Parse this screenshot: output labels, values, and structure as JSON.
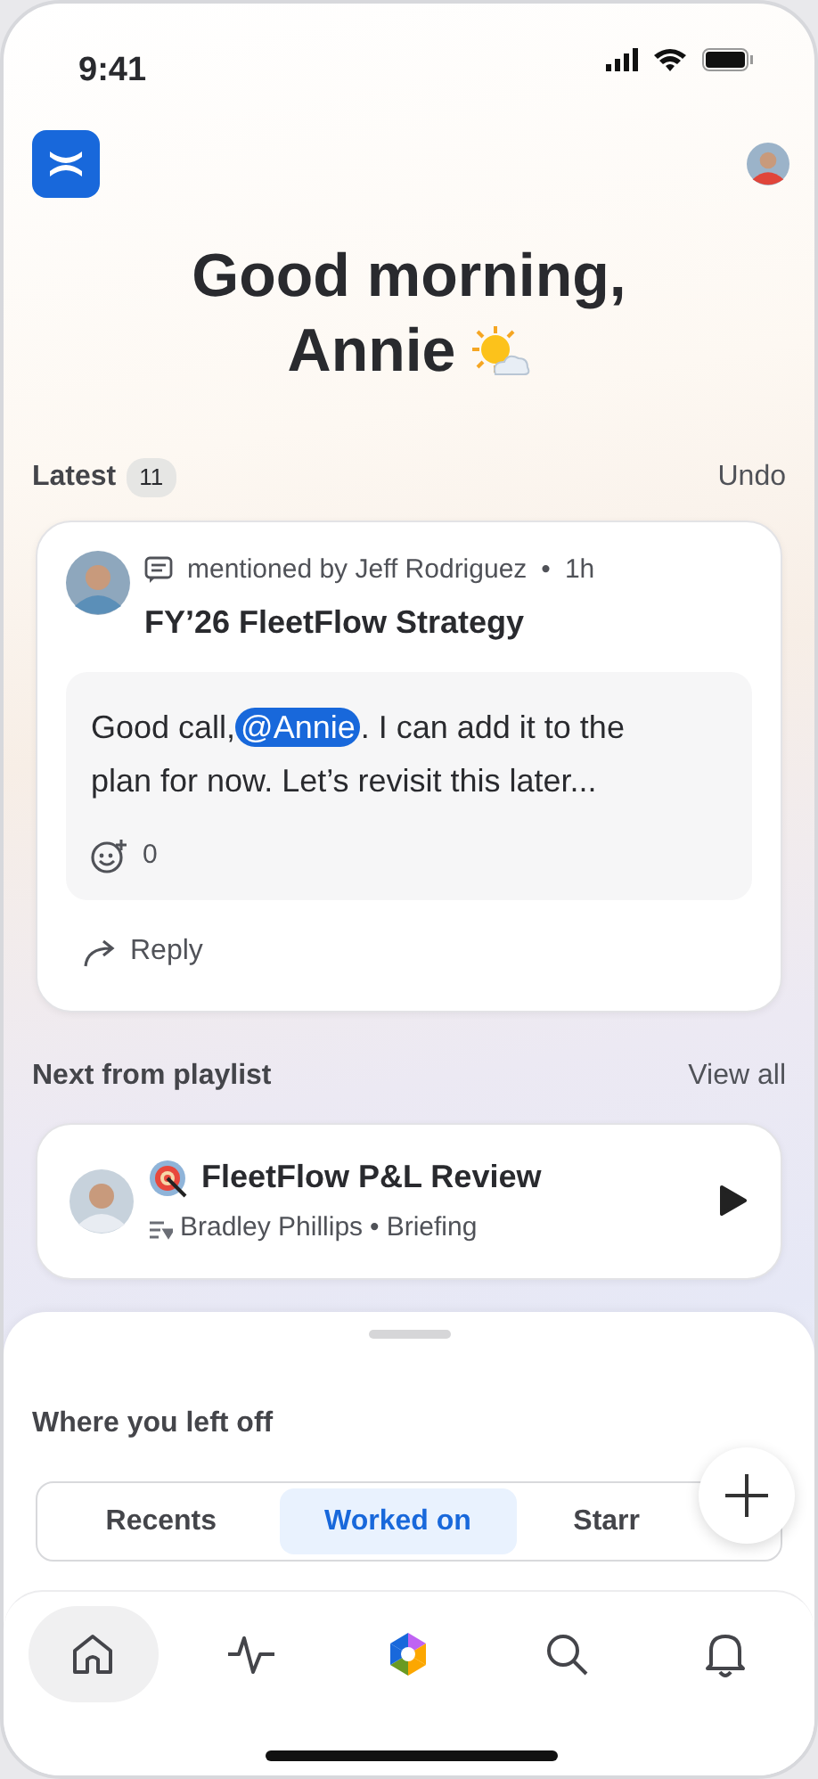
{
  "status_bar": {
    "time": "9:41"
  },
  "greeting": {
    "line_1": "Good morning,",
    "line_2": "Annie"
  },
  "latest": {
    "title": "Latest",
    "count": "11",
    "action": "Undo",
    "card": {
      "meta": "mentioned by Jeff Rodriguez",
      "separator": "•",
      "time": "1h",
      "title": "FY’26 FleetFlow Strategy",
      "message": [
        {
          "kind": "text",
          "text": "Good call,"
        },
        {
          "kind": "mention",
          "text": "@Annie"
        },
        {
          "kind": "text",
          "text": ". I can add it to the plan for now. Let’s revisit this later..."
        }
      ],
      "reactions": "0",
      "reply": "Reply"
    }
  },
  "playlist": {
    "title": "Next from playlist",
    "action": "View all",
    "item": {
      "title": "FleetFlow P&L Review",
      "author": "Bradley Phillips",
      "separator": "•",
      "type": "Briefing"
    }
  },
  "left_off": {
    "title": "Where you left off",
    "tabs": [
      {
        "label": "Recents",
        "selected": false
      },
      {
        "label": "Worked on",
        "selected": true
      },
      {
        "label": "Starr",
        "selected": false
      }
    ]
  },
  "nav": [
    {
      "kind": "home",
      "selected": true
    },
    {
      "kind": "activity",
      "selected": false
    },
    {
      "kind": "ai",
      "selected": false
    },
    {
      "kind": "search",
      "selected": false
    },
    {
      "kind": "notifications",
      "selected": false
    }
  ]
}
